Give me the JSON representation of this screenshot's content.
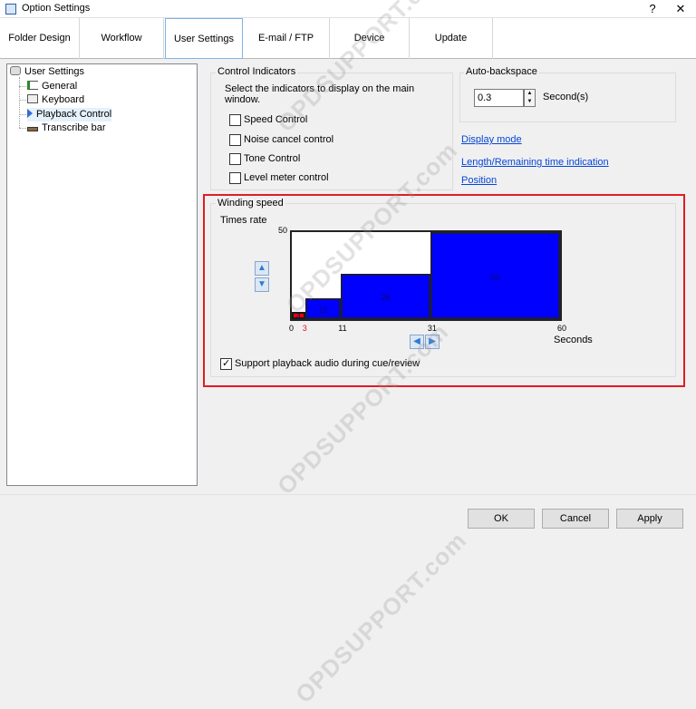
{
  "window": {
    "title": "Option Settings",
    "help_glyph": "?",
    "close_glyph": "✕"
  },
  "tabs": [
    {
      "label": "Folder Design"
    },
    {
      "label": "Workflow"
    },
    {
      "label": "User Settings"
    },
    {
      "label": "E-mail / FTP"
    },
    {
      "label": "Device"
    },
    {
      "label": "Update"
    }
  ],
  "tree": {
    "root": "User Settings",
    "items": [
      "General",
      "Keyboard",
      "Playback Control",
      "Transcribe bar"
    ]
  },
  "control_indicators": {
    "title": "Control Indicators",
    "description_line1": "Select the indicators to display on the main",
    "description_line2": "window.",
    "options": [
      {
        "label": "Speed Control",
        "checked": false
      },
      {
        "label": "Noise cancel control",
        "checked": false
      },
      {
        "label": "Tone Control",
        "checked": false
      },
      {
        "label": "Level meter control",
        "checked": false
      }
    ]
  },
  "auto_backspace": {
    "title": "Auto-backspace",
    "value": "0.3",
    "unit": "Second(s)"
  },
  "links": {
    "display_mode": "Display mode",
    "length_remaining": "Length/Remaining time indication",
    "position": "Position"
  },
  "winding_speed": {
    "title": "Winding speed",
    "times_rate_label": "Times rate",
    "seconds_label": "Seconds",
    "support_audio_label": "Support playback audio during cue/review",
    "support_audio_checked": true
  },
  "chart_data": {
    "type": "bar",
    "bars": [
      {
        "x_start": 0,
        "x_end": 3,
        "value": 4,
        "label": "4",
        "color": "#ff0000"
      },
      {
        "x_start": 3,
        "x_end": 11,
        "value": 12,
        "label": "12",
        "color": "#0000ff"
      },
      {
        "x_start": 11,
        "x_end": 31,
        "value": 26,
        "label": "26",
        "color": "#0000ff"
      },
      {
        "x_start": 31,
        "x_end": 60,
        "value": 50,
        "label": "50",
        "color": "#0000ff"
      }
    ],
    "y_max_label": "50",
    "xlim": [
      0,
      60
    ],
    "ylim": [
      0,
      50
    ],
    "x_ticks": [
      {
        "value": 0,
        "label": "0"
      },
      {
        "value": 3,
        "label": "3",
        "color": "#e01c24"
      },
      {
        "value": 11,
        "label": "11"
      },
      {
        "value": 31,
        "label": "31"
      },
      {
        "value": 60,
        "label": "60"
      }
    ]
  },
  "buttons": {
    "ok": "OK",
    "cancel": "Cancel",
    "apply": "Apply"
  },
  "watermark": "OPDSUPPORT.com"
}
